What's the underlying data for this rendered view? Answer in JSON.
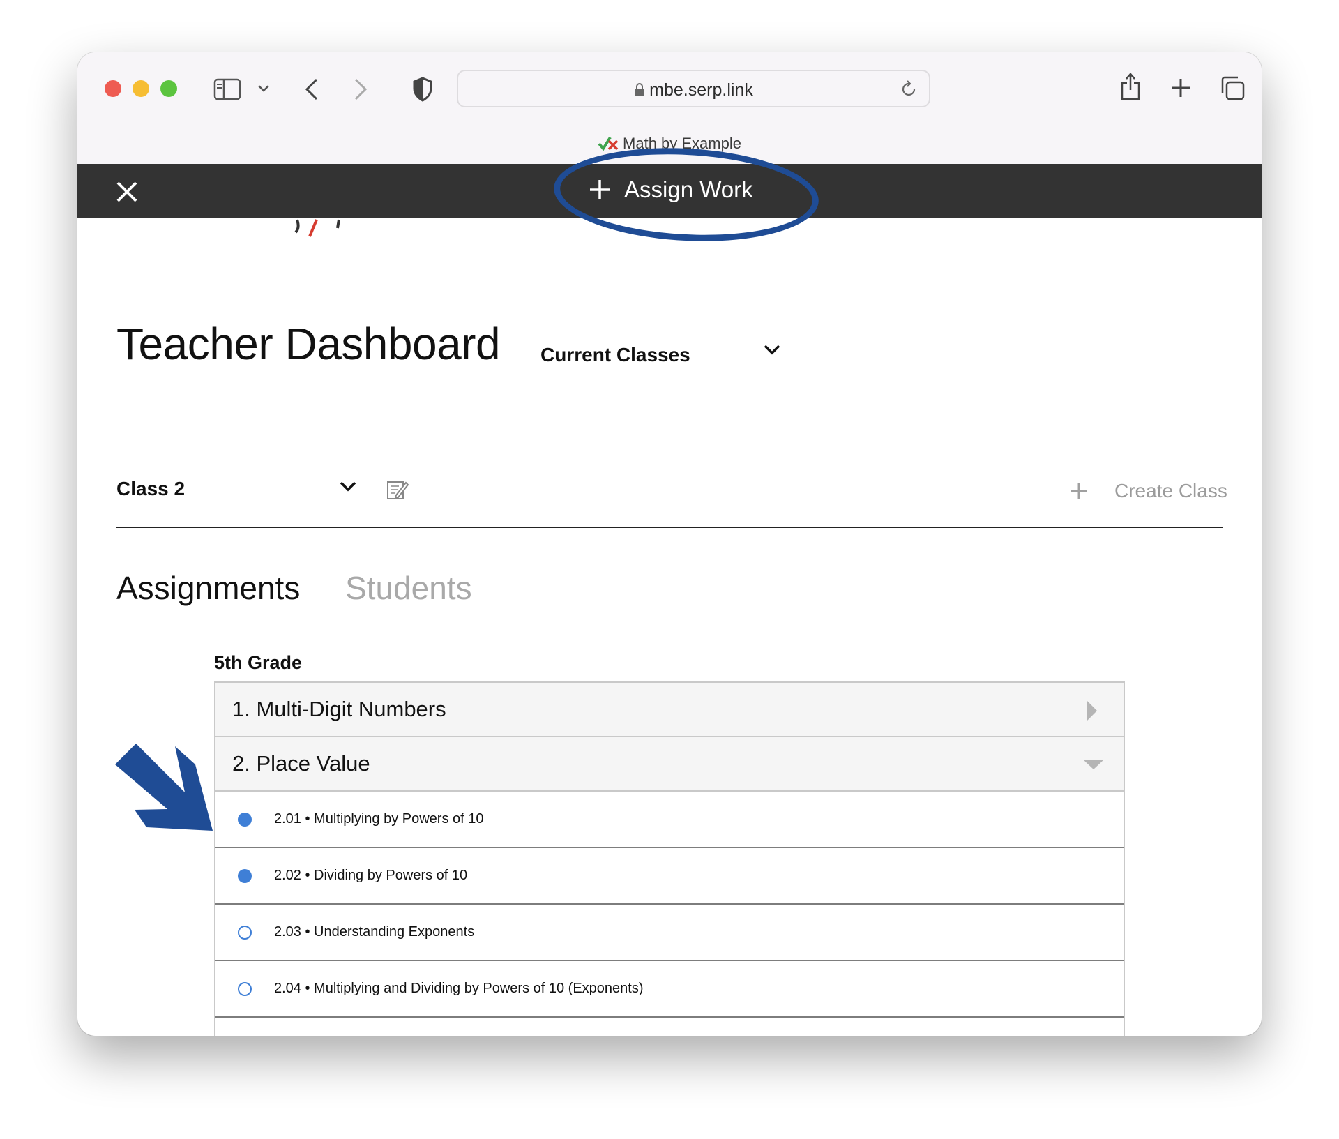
{
  "browser": {
    "url": "mbe.serp.link",
    "tab_title": "Math by Example"
  },
  "topbar": {
    "assign_work_label": "Assign Work"
  },
  "dashboard": {
    "title": "Teacher Dashboard",
    "class_filter": "Current Classes",
    "selected_class": "Class 2",
    "create_class_label": "Create Class"
  },
  "tabs": [
    {
      "label": "Assignments",
      "active": true
    },
    {
      "label": "Students",
      "active": false
    }
  ],
  "curriculum": {
    "grade": "5th Grade",
    "units": [
      {
        "label": "1. Multi-Digit Numbers",
        "expanded": false
      },
      {
        "label": "2. Place Value",
        "expanded": true
      }
    ],
    "lessons": [
      {
        "label": "2.01 • Multiplying by Powers of 10",
        "assigned": true
      },
      {
        "label": "2.02 • Dividing by Powers of 10",
        "assigned": true
      },
      {
        "label": "2.03 • Understanding Exponents",
        "assigned": false
      },
      {
        "label": "2.04 • Multiplying and Dividing by Powers of 10 (Exponents)",
        "assigned": false
      }
    ]
  },
  "colors": {
    "annotation_blue": "#1f4c95",
    "dot_blue": "#3f7fd6",
    "topbar_dark": "#333333"
  }
}
